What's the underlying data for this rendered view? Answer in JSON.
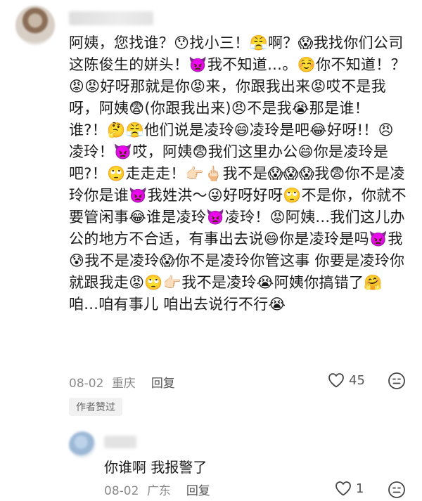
{
  "comment": {
    "text": "阿姨，您找谁？😯找小三！😤啊？😱我找你们公司这陈俊生的姘头！👿我不知道…。☺️你不知道！？😡😡好呀那就是你😡来，你跟我出来😡哎不是我呀，阿姨😨(你跟我出来)😠不是我😭那是谁！谁?！🤔😤他们说是凌玲😄凌玲是吧😂好呀!！😠凌玲！👿哎，阿姨😨我们这里办公😄你是凌玲是吧?！🙄走走走！👉🏻🖕🏻我不是😱😱😱我😨你不是凌玲你是谁👿我姓洪～😜好呀好呀🙄不是你，你就不要管闲事😂谁是凌玲👿凌玲！😡阿姨...我们这儿办公的地方不合适，有事出去说😄你是凌玲是吗👿我😰我不是凌玲😱你不是凌玲你管这事 你要是凌玲你就跟我走😡🙄👉🏻我不是凌玲😭阿姨你搞错了🤗咱...咱有事儿 咱出去说行不行😭",
    "date": "08-02",
    "location": "重庆",
    "reply_label": "回复",
    "like_count": "45",
    "badge": "作者赞过"
  },
  "sub_reply": {
    "text": "你谁啊 我报警了",
    "date": "08-02",
    "location": "广东",
    "reply_label": "回复",
    "like_count": "1"
  },
  "icons": {
    "like": "heart-outline-icon",
    "dislike": "dislike-face-icon"
  }
}
